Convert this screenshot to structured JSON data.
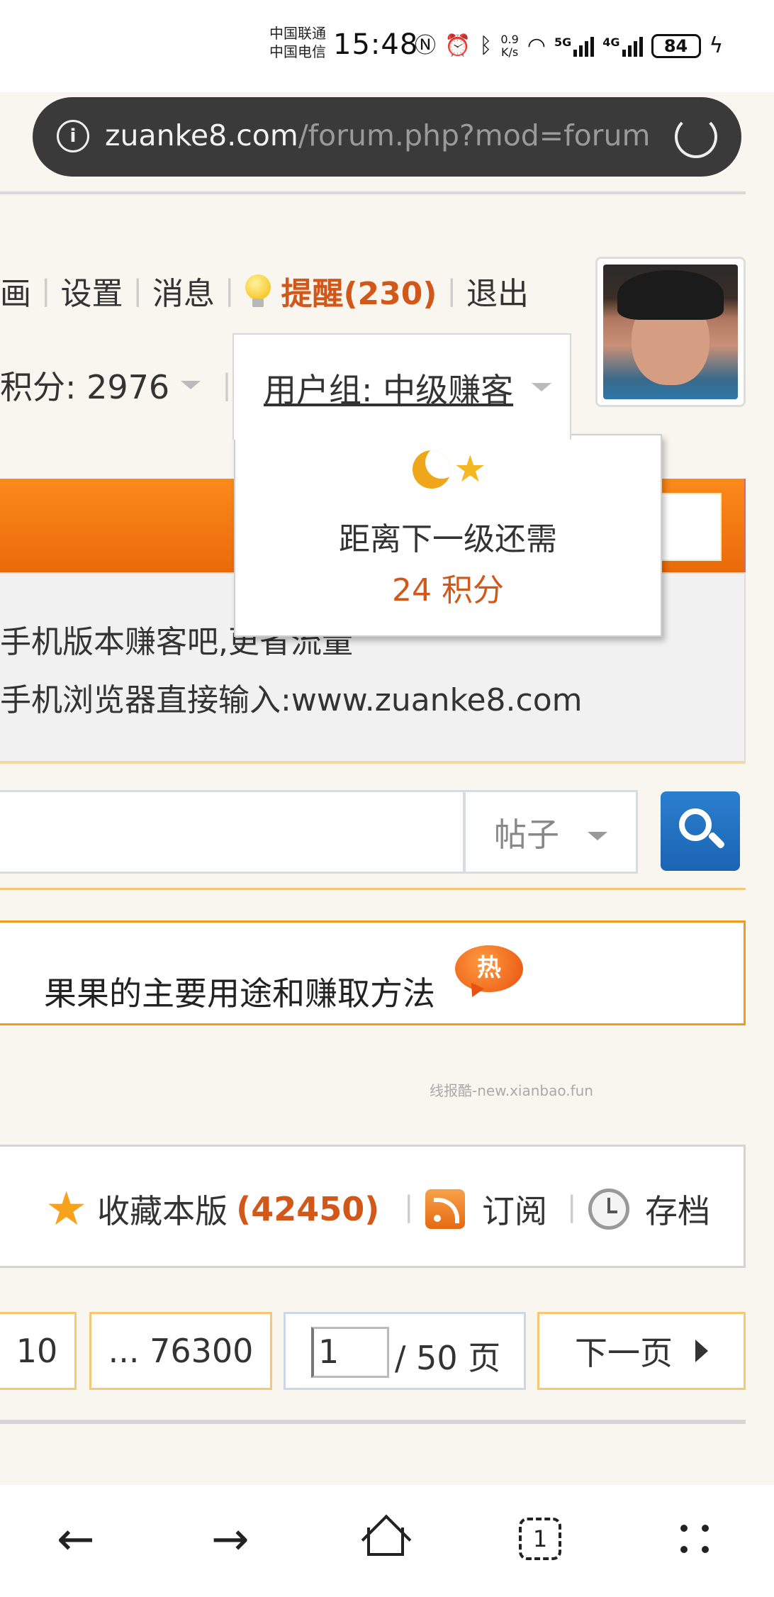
{
  "status_bar": {
    "carrier_1": "中国联通",
    "carrier_2": "中国电信",
    "time": "15:48",
    "net_speed_value": "0.9",
    "net_speed_unit": "K/s",
    "sig_tag_1": "5G",
    "sig_tag_2": "4G",
    "battery": "84",
    "icons": [
      "nfc-icon",
      "alarm-icon",
      "bluetooth-icon",
      "wifi-icon",
      "signal-5g-icon",
      "signal-4g-icon",
      "battery-icon",
      "charging-icon"
    ]
  },
  "url_bar": {
    "host": "zuanke8.com",
    "path": "/forum.php?mod=forum"
  },
  "user_nav": {
    "item_partial": "画",
    "settings": "设置",
    "messages": "消息",
    "remind": "提醒(230)",
    "logout": "退出"
  },
  "user_info": {
    "credits": "积分: 2976",
    "group": "用户组: 中级赚客"
  },
  "popup": {
    "line1": "距离下一级还需",
    "line2": "24 积分"
  },
  "notice": {
    "line1": "手机版本赚客吧,更省流量",
    "line2": "手机浏览器直接输入:www.zuanke8.com"
  },
  "search": {
    "input_value": "",
    "type_selected": "帖子"
  },
  "hot_banner": {
    "text": "果果的主要用途和赚取方法",
    "badge": "热"
  },
  "watermark": "线报酷-new.xianbao.fun",
  "actions": {
    "favorite_label": "收藏本版",
    "favorite_count": "(42450)",
    "subscribe_label": "订阅",
    "archive_label": "存档"
  },
  "pagination": {
    "page_10": "10",
    "last_page": "... 76300",
    "current_page": "1",
    "total": "/ 50 页",
    "next": "下一页"
  },
  "colors": {
    "accent_orange": "#d2581a",
    "bar_orange": "#f07a12",
    "search_blue": "#1f6ec1"
  }
}
